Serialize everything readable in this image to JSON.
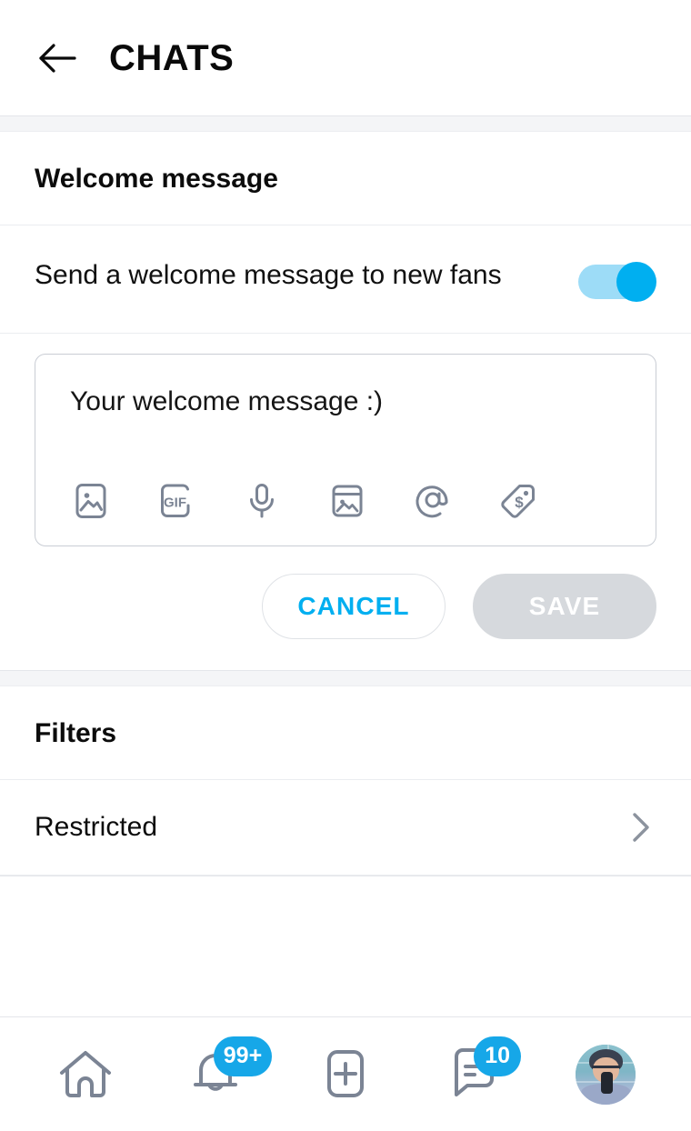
{
  "header": {
    "back_icon": "back-arrow-icon",
    "title": "CHATS"
  },
  "welcome_section": {
    "section_title": "Welcome message",
    "toggle_label": "Send a welcome message to new fans",
    "toggle_state": "on",
    "toggle_on_color": "#00aff0",
    "toggle_track_color": "#9ddcf7",
    "composer": {
      "placeholder": "Your welcome message :)",
      "value": "",
      "icons": [
        {
          "name": "image-icon",
          "label": "Photo"
        },
        {
          "name": "gif-icon",
          "label": "GIF"
        },
        {
          "name": "microphone-icon",
          "label": "Voice message"
        },
        {
          "name": "media-vault-icon",
          "label": "Vault media"
        },
        {
          "name": "at-mention-icon",
          "label": "Mention"
        },
        {
          "name": "price-tag-icon",
          "label": "Paid message"
        }
      ]
    },
    "buttons": {
      "cancel_label": "CANCEL",
      "cancel_color": "#00aff0",
      "save_label": "SAVE",
      "save_disabled": true,
      "save_bg": "#d6d9dd"
    }
  },
  "filters_section": {
    "section_title": "Filters",
    "rows": [
      {
        "label": "Restricted",
        "chevron": "chevron-right-icon"
      }
    ]
  },
  "bottom_nav": {
    "items": [
      {
        "name": "home",
        "icon": "home-icon",
        "badge": null
      },
      {
        "name": "notifications",
        "icon": "bell-icon",
        "badge": "99+"
      },
      {
        "name": "new-post",
        "icon": "plus-square-icon",
        "badge": null
      },
      {
        "name": "messages",
        "icon": "chat-bubble-icon",
        "badge": "10"
      },
      {
        "name": "profile",
        "icon": "avatar",
        "badge": null
      }
    ],
    "badge_color": "#16a7e8"
  }
}
